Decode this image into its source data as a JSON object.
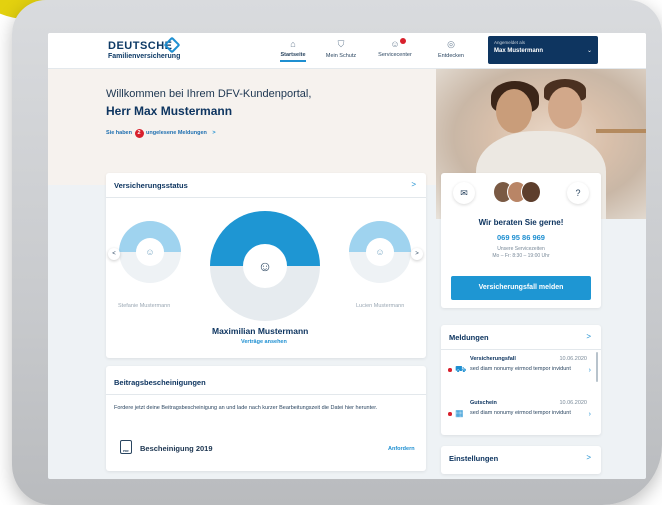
{
  "logo": {
    "line1": "DEUTSCHE",
    "line2": "Familienversicherung"
  },
  "nav": [
    {
      "label": "Startseite",
      "icon": "home-icon",
      "glyph": "⌂"
    },
    {
      "label": "Mein Schutz",
      "icon": "shield-icon",
      "glyph": "⛉"
    },
    {
      "label": "Servicecenter",
      "icon": "person-icon",
      "glyph": "☺"
    },
    {
      "label": "Entdecken",
      "icon": "compass-icon",
      "glyph": "◎"
    }
  ],
  "account": {
    "label": "Angemeldet als",
    "name": "Max Mustermann"
  },
  "hero": {
    "welcome": "Willkommen bei Ihrem DFV-Kundenportal,",
    "name": "Herr Max Mustermann",
    "unread_prefix": "Sie haben",
    "unread_count": "2",
    "unread_suffix": "ungelesene Meldungen",
    "unread_chevron": ">"
  },
  "versicherungsstatus": {
    "title": "Versicherungsstatus",
    "chevron": ">",
    "left_person": "Stefanie Mustermann",
    "center_person": "Maximilian Mustermann",
    "right_person": "Lucien Mustermann",
    "link": "Verträge ansehen",
    "prev": "<",
    "next": ">"
  },
  "beitrag": {
    "title": "Beitragsbescheinigungen",
    "description": "Fordere jetzt deine Beitragsbescheinigung an und lade nach kurzer Bearbeitungszeit die Datei hier herunter.",
    "file_type": "PDF",
    "document": "Bescheinigung 2019",
    "action": "Anfordern"
  },
  "advice": {
    "mail_icon": "✉",
    "help_icon": "?",
    "title": "Wir beraten Sie gerne!",
    "phone": "069 95 86 969",
    "subtitle": "Unsere Servicezeiten",
    "hours": "Mo – Fr: 8:30 – 19:00 Uhr",
    "button": "Versicherungsfall melden"
  },
  "meldungen": {
    "title": "Meldungen",
    "chevron": ">",
    "items": [
      {
        "category": "Versicherungsfall",
        "date": "10.06.2020",
        "text": "sed diam nonumy eirmod tempor invidunt",
        "icon": "car-icon",
        "glyph": "⛟"
      },
      {
        "category": "Gutschein",
        "date": "10.06.2020",
        "text": "sed diam nonumy eirmod tempor invidunt",
        "icon": "gift-icon",
        "glyph": "🎁"
      }
    ]
  },
  "einstellungen": {
    "title": "Einstellungen",
    "chevron": ">"
  },
  "colors": {
    "brand_dark": "#0e3560",
    "accent": "#1e96d3",
    "alert": "#d8202c",
    "yellow": "#e3d10f"
  }
}
